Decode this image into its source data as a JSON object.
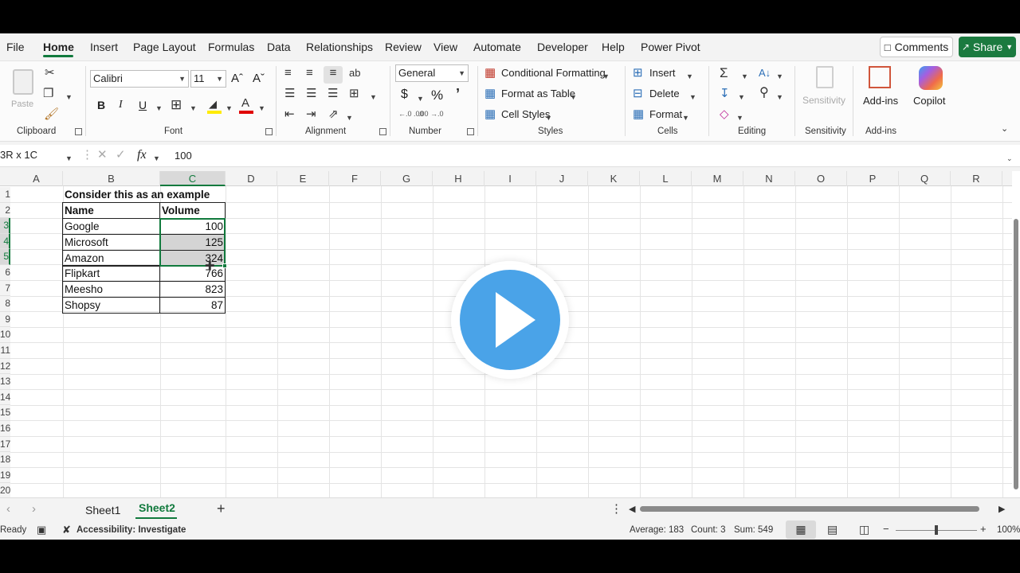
{
  "menu": {
    "tabs": [
      "File",
      "Home",
      "Insert",
      "Page Layout",
      "Formulas",
      "Data",
      "Relationships",
      "Review",
      "View",
      "Automate",
      "Developer",
      "Help",
      "Power Pivot"
    ],
    "comments_label": "Comments",
    "share_label": "Share"
  },
  "ribbon": {
    "clipboard": {
      "label": "Clipboard",
      "paste": "Paste"
    },
    "font": {
      "label": "Font",
      "name": "Calibri",
      "size": "11",
      "bold": "B",
      "italic": "I",
      "underline": "U",
      "grow": "Aˆ",
      "shrink": "Aˇ"
    },
    "alignment": {
      "label": "Alignment"
    },
    "number": {
      "label": "Number",
      "format": "General",
      "currency": "$",
      "percent": "%",
      "comma": "’",
      "inc_dec": "←.0 .00",
      "dec_dec": ".00 →.0"
    },
    "styles": {
      "label": "Styles",
      "conditional": "Conditional Formatting",
      "format_table": "Format as Table",
      "cell_styles": "Cell Styles"
    },
    "cells": {
      "label": "Cells",
      "insert": "Insert",
      "delete": "Delete",
      "format": "Format"
    },
    "editing": {
      "label": "Editing"
    },
    "sensitivity": {
      "label": "Sensitivity",
      "button": "Sensitivity"
    },
    "addins": {
      "label": "Add-ins",
      "button": "Add-ins"
    },
    "copilot": {
      "button": "Copilot"
    }
  },
  "formula_bar": {
    "name_box": "3R x 1C",
    "fx": "fx",
    "value": "100"
  },
  "columns": [
    "A",
    "B",
    "C",
    "D",
    "E",
    "F",
    "G",
    "H",
    "I",
    "J",
    "K",
    "L",
    "M",
    "N",
    "O",
    "P",
    "Q",
    "R"
  ],
  "rows": [
    "1",
    "2",
    "3",
    "4",
    "5",
    "6",
    "7",
    "8",
    "9",
    "10",
    "11",
    "12",
    "13",
    "14",
    "15",
    "16",
    "17",
    "18",
    "19",
    "20"
  ],
  "sheet": {
    "title": "Consider this as an example",
    "header_name": "Name",
    "header_volume": "Volume",
    "records": [
      {
        "name": "Google",
        "volume": "100"
      },
      {
        "name": "Microsoft",
        "volume": "125"
      },
      {
        "name": "Amazon",
        "volume": "324"
      },
      {
        "name": "Flipkart",
        "volume": "766"
      },
      {
        "name": "Meesho",
        "volume": "823"
      },
      {
        "name": "Shopsy",
        "volume": "87"
      }
    ]
  },
  "sheet_tabs": [
    "Sheet1",
    "Sheet2"
  ],
  "active_sheet": "Sheet2",
  "status": {
    "ready": "Ready",
    "accessibility": "Accessibility: Investigate",
    "average": "Average: 183",
    "count": "Count: 3",
    "sum": "Sum: 549",
    "zoom": "100%"
  },
  "colors": {
    "accent": "#117a3d",
    "share": "#1b7a3f",
    "play": "#4aa3e8"
  }
}
